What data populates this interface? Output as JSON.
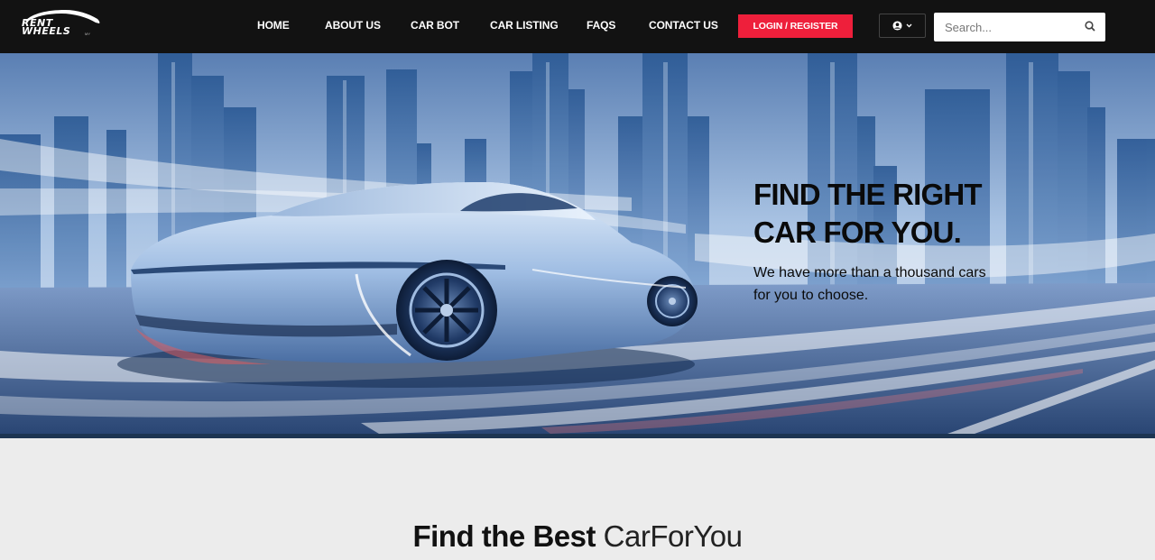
{
  "brand": {
    "line1": "RENT",
    "line2": "WHEELS",
    "suffix": "MY"
  },
  "nav": {
    "items": [
      {
        "label": "HOME"
      },
      {
        "label": "ABOUT US"
      },
      {
        "label": "CAR BOT"
      },
      {
        "label": "CAR LISTING"
      },
      {
        "label": "FAQS"
      },
      {
        "label": "CONTACT US"
      }
    ],
    "login_label": "LOGIN / REGISTER",
    "account_icon": "user-circle-icon",
    "dropdown_icon": "chevron-down-icon"
  },
  "search": {
    "placeholder": "Search...",
    "value": "",
    "icon": "search-icon"
  },
  "hero": {
    "title_line1": "FIND THE RIGHT",
    "title_line2": "CAR FOR YOU.",
    "subtitle": "We have more than a thousand cars for you to choose."
  },
  "section": {
    "title_bold": "Find the Best",
    "title_light": "CarForYou"
  },
  "colors": {
    "nav_bg": "#121212",
    "accent": "#ee1f3b",
    "page_bg": "#ececec"
  }
}
